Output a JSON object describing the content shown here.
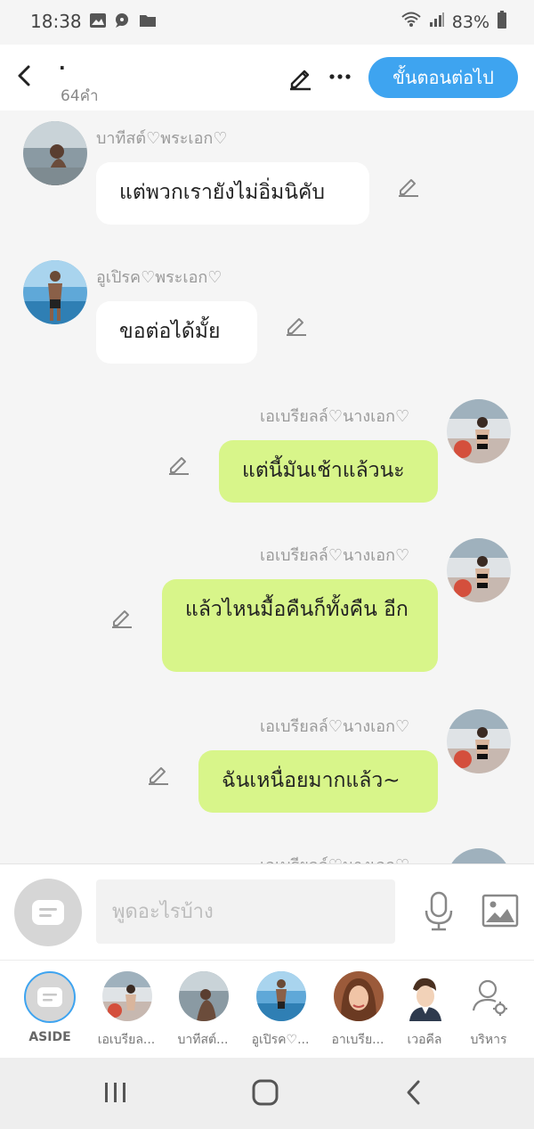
{
  "status_bar": {
    "time": "18:38",
    "battery": "83%"
  },
  "header": {
    "title": "·",
    "word_count": "64คำ",
    "next_button": "ขั้นตอนต่อไป"
  },
  "messages": [
    {
      "side": "left",
      "name": "บาทีสต์♡พระเอก♡",
      "text": "แต่พวกเรายังไม่อิ่มนิคับ"
    },
    {
      "side": "left",
      "name": "อูเปิรค♡พระเอก♡",
      "text": "ขอต่อได้มั้ย"
    },
    {
      "side": "right",
      "name": "เอเบรียลล์♡นางเอก♡",
      "text": "แต่นี้มันเช้าแล้วนะ"
    },
    {
      "side": "right",
      "name": "เอเบรียลล์♡นางเอก♡",
      "text": "แล้วไหนมื้อคืนก็ทั้งคืน อีก"
    },
    {
      "side": "right",
      "name": "เอเบรียลล์♡นางเอก♡",
      "text": "ฉันเหนื่อยมากแล้ว~"
    },
    {
      "side": "right",
      "name": "เอเบรียลล์♡นางเอก♡",
      "text": ""
    }
  ],
  "composer": {
    "placeholder": "พูดอะไรบ้าง"
  },
  "characters": [
    {
      "label": "ASIDE"
    },
    {
      "label": "เอเบรียล..."
    },
    {
      "label": "บาทีสต์..."
    },
    {
      "label": "อูเปิรค♡..."
    },
    {
      "label": "อาเบรีย..."
    },
    {
      "label": "เวอคีล"
    },
    {
      "label": "บริหาร"
    }
  ],
  "colors": {
    "accent_blue": "#3ea4f0",
    "right_bubble": "#d8f58a",
    "left_bubble": "#ffffff",
    "background": "#f5f5f5"
  }
}
